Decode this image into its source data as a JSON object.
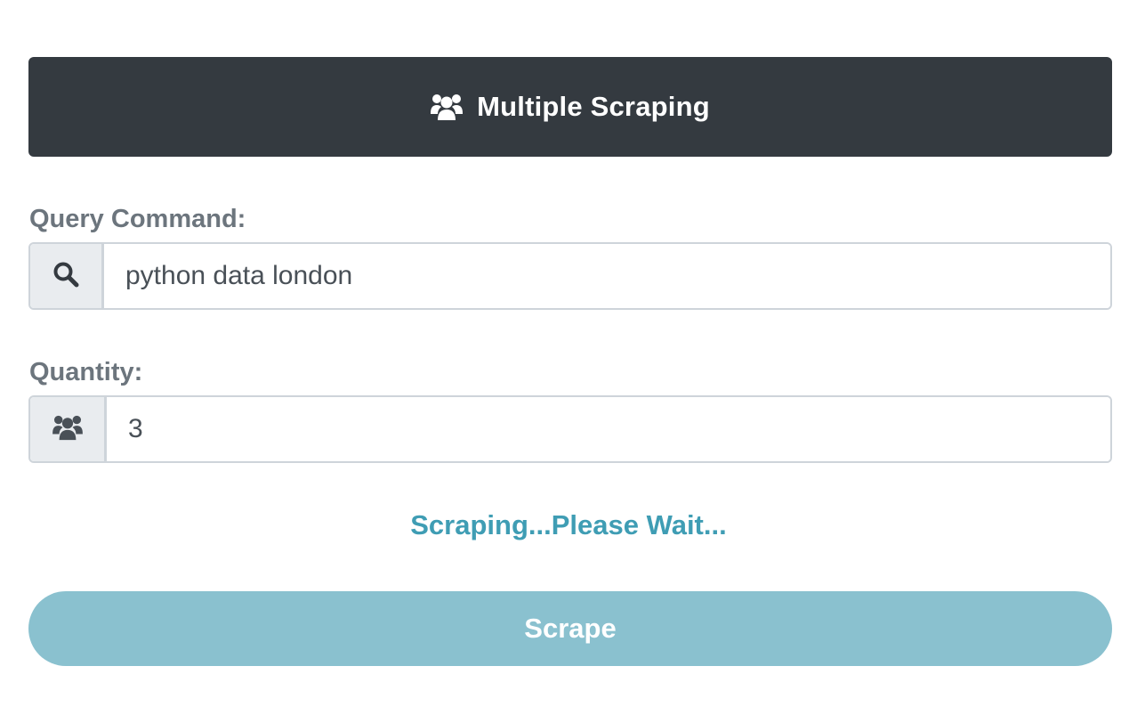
{
  "header": {
    "icon": "users-icon",
    "title": "Multiple Scraping"
  },
  "query": {
    "label": "Query Command:",
    "icon": "search-icon",
    "value": "python data london"
  },
  "quantity": {
    "label": "Quantity:",
    "icon": "users-icon",
    "value": "3"
  },
  "status": {
    "text": "Scraping...Please Wait..."
  },
  "button": {
    "label": "Scrape"
  },
  "colors": {
    "header_bg": "#343a40",
    "label": "#6c757d",
    "status": "#3f9db4",
    "button_bg": "#8ac1cf",
    "addon_bg": "#e9ecef",
    "border": "#ced4da"
  }
}
